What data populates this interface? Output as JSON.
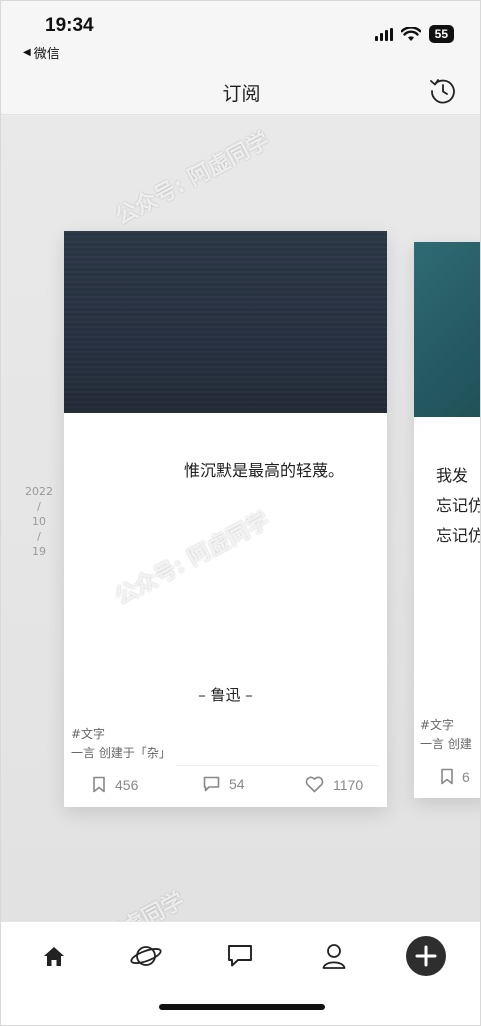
{
  "status_bar": {
    "time": "19:34",
    "back_app": "微信",
    "battery": "55"
  },
  "nav": {
    "title": "订阅"
  },
  "date": {
    "year": "2022",
    "sep1": "/",
    "month": "10",
    "sep2": "/",
    "day": "19"
  },
  "card": {
    "quote": "惟沉默是最高的轻蔑。",
    "author": "– 鲁迅 –",
    "tag": "#文字",
    "creator": "一言 创建于「杂」",
    "bookmarks": "456",
    "comments": "54",
    "likes": "1170"
  },
  "peek_card": {
    "line1": "我发",
    "line2": "忘记仿",
    "line3": "忘记仿",
    "tag": "#文字",
    "creator": "一言 创建",
    "bookmarks": "6"
  },
  "watermark": "公众号: 阿虚同学",
  "icons": {
    "history": "history-clock-icon",
    "bookmark": "bookmark-icon",
    "comment": "comment-icon",
    "like": "heart-icon",
    "home": "home-icon",
    "discover": "planet-icon",
    "messages": "chat-icon",
    "profile": "user-icon",
    "add": "plus-icon"
  },
  "colors": {
    "add_button": "#2e2e2e",
    "card_image": "#263040",
    "peek_image": "#2f6a72"
  }
}
